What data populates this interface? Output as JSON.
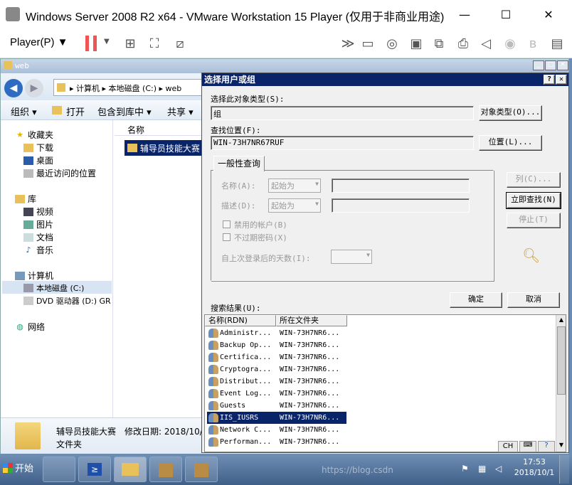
{
  "vm_window": {
    "title": "Windows Server 2008 R2 x64 - VMware Workstation 15 Player (仅用于非商业用途)",
    "min": "—",
    "max": "☐",
    "close": "✕"
  },
  "vm_toolbar": {
    "player_menu": "Player(P)",
    "icons": [
      "pause-icon",
      "send-ctrl-alt-del-icon",
      "fullscreen-icon",
      "unity-icon",
      "send-keys-icon",
      "hdd-icon",
      "cd-icon",
      "floppy-icon",
      "network-icon",
      "printer-icon",
      "sound-icon",
      "camera-icon",
      "bluetooth-icon",
      "message-log-icon"
    ]
  },
  "explorer": {
    "title": "web",
    "address": [
      "计算机",
      "本地磁盘 (C:)",
      "web"
    ],
    "commands": [
      "组织 ▾",
      "打开",
      "包含到库中 ▾",
      "共享 ▾"
    ],
    "nav": {
      "favorites": "收藏夹",
      "fav_items": [
        "下载",
        "桌面",
        "最近访问的位置"
      ],
      "libraries": "库",
      "lib_items": [
        "视频",
        "图片",
        "文档",
        "音乐"
      ],
      "computer": "计算机",
      "comp_items": [
        "本地磁盘 (C:)",
        "DVD 驱动器 (D:) GR"
      ],
      "network": "网络"
    },
    "column_name": "名称",
    "selected_file": "辅导员技能大赛",
    "details": {
      "name": "辅导员技能大赛",
      "modified": "修改日期: 2018/10/",
      "type": "文件夹"
    }
  },
  "dialog": {
    "title": "选择用户或组",
    "help": "?",
    "close": "✕",
    "obj_type_label": "选择此对象类型(S):",
    "obj_type_value": "组",
    "obj_type_btn": "对象类型(O)...",
    "location_label": "查找位置(F):",
    "location_value": "WIN-73H7NR67RUF",
    "location_btn": "位置(L)...",
    "tab": "一般性查询",
    "name_label": "名称(A):",
    "name_mode": "起始为",
    "desc_label": "描述(D):",
    "desc_mode": "起始为",
    "disabled_accounts": "禁用的帐户(B)",
    "nonexpiring": "不过期密码(X)",
    "days_label": "自上次登录后的天数(I):",
    "col_btn": "列(C)...",
    "find_btn": "立即查找(N)",
    "stop_btn": "停止(T)",
    "ok_btn": "确定",
    "cancel_btn": "取消",
    "results_label": "搜索结果(U):",
    "results_headers": [
      "名称(RDN)",
      "所在文件夹"
    ],
    "results": [
      {
        "name": "Administr...",
        "folder": "WIN-73H7NR6..."
      },
      {
        "name": "Backup Op...",
        "folder": "WIN-73H7NR6..."
      },
      {
        "name": "Certifica...",
        "folder": "WIN-73H7NR6..."
      },
      {
        "name": "Cryptogra...",
        "folder": "WIN-73H7NR6..."
      },
      {
        "name": "Distribut...",
        "folder": "WIN-73H7NR6..."
      },
      {
        "name": "Event Log...",
        "folder": "WIN-73H7NR6..."
      },
      {
        "name": "Guests",
        "folder": "WIN-73H7NR6..."
      },
      {
        "name": "IIS_IUSRS",
        "folder": "WIN-73H7NR6..."
      },
      {
        "name": "Network C...",
        "folder": "WIN-73H7NR6..."
      },
      {
        "name": "Performan...",
        "folder": "WIN-73H7NR6..."
      }
    ],
    "selected_index": 7
  },
  "taskbar": {
    "start": "开始",
    "lang": "CH",
    "time": "17:53",
    "date": "2018/10/1",
    "watermark": "https://blog.csdn"
  }
}
